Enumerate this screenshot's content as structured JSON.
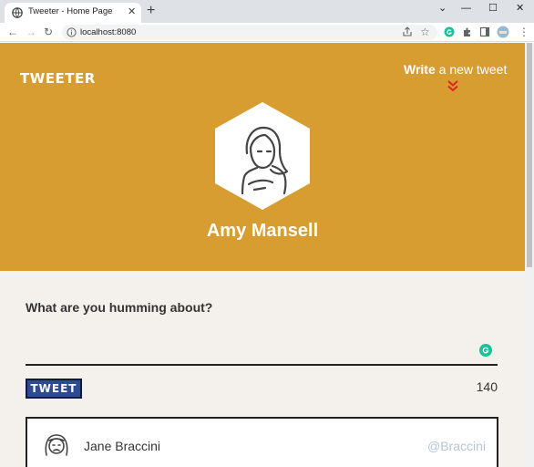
{
  "browser": {
    "tab_title": "Tweeter - Home Page",
    "tab_close": "✕",
    "new_tab": "+",
    "url": "localhost:8080",
    "window_controls": {
      "dropdown": "⌄",
      "minimize": "—",
      "maximize": "☐",
      "close": "✕"
    },
    "back": "←",
    "forward": "→",
    "reload": "↻",
    "star": "☆",
    "menu": "⋮"
  },
  "header": {
    "brand": "TWEETER",
    "write_bold": "Write",
    "write_rest": " a new tweet",
    "icon_write": "chevron-double-down-icon"
  },
  "profile": {
    "name": "Amy Mansell"
  },
  "compose": {
    "label": "What are you humming about?",
    "input_value": "",
    "tweet_button": "TWEET",
    "counter": "140"
  },
  "tweets": [
    {
      "name": "Jane Braccini",
      "handle": "@Braccini"
    }
  ],
  "colors": {
    "hero": "#d89d30",
    "page_bg": "#f4f1ec",
    "tweet_button": "#2e4a91",
    "chevron": "#e02424",
    "handle": "#b8c4d8",
    "grammarly": "#15c39a"
  }
}
